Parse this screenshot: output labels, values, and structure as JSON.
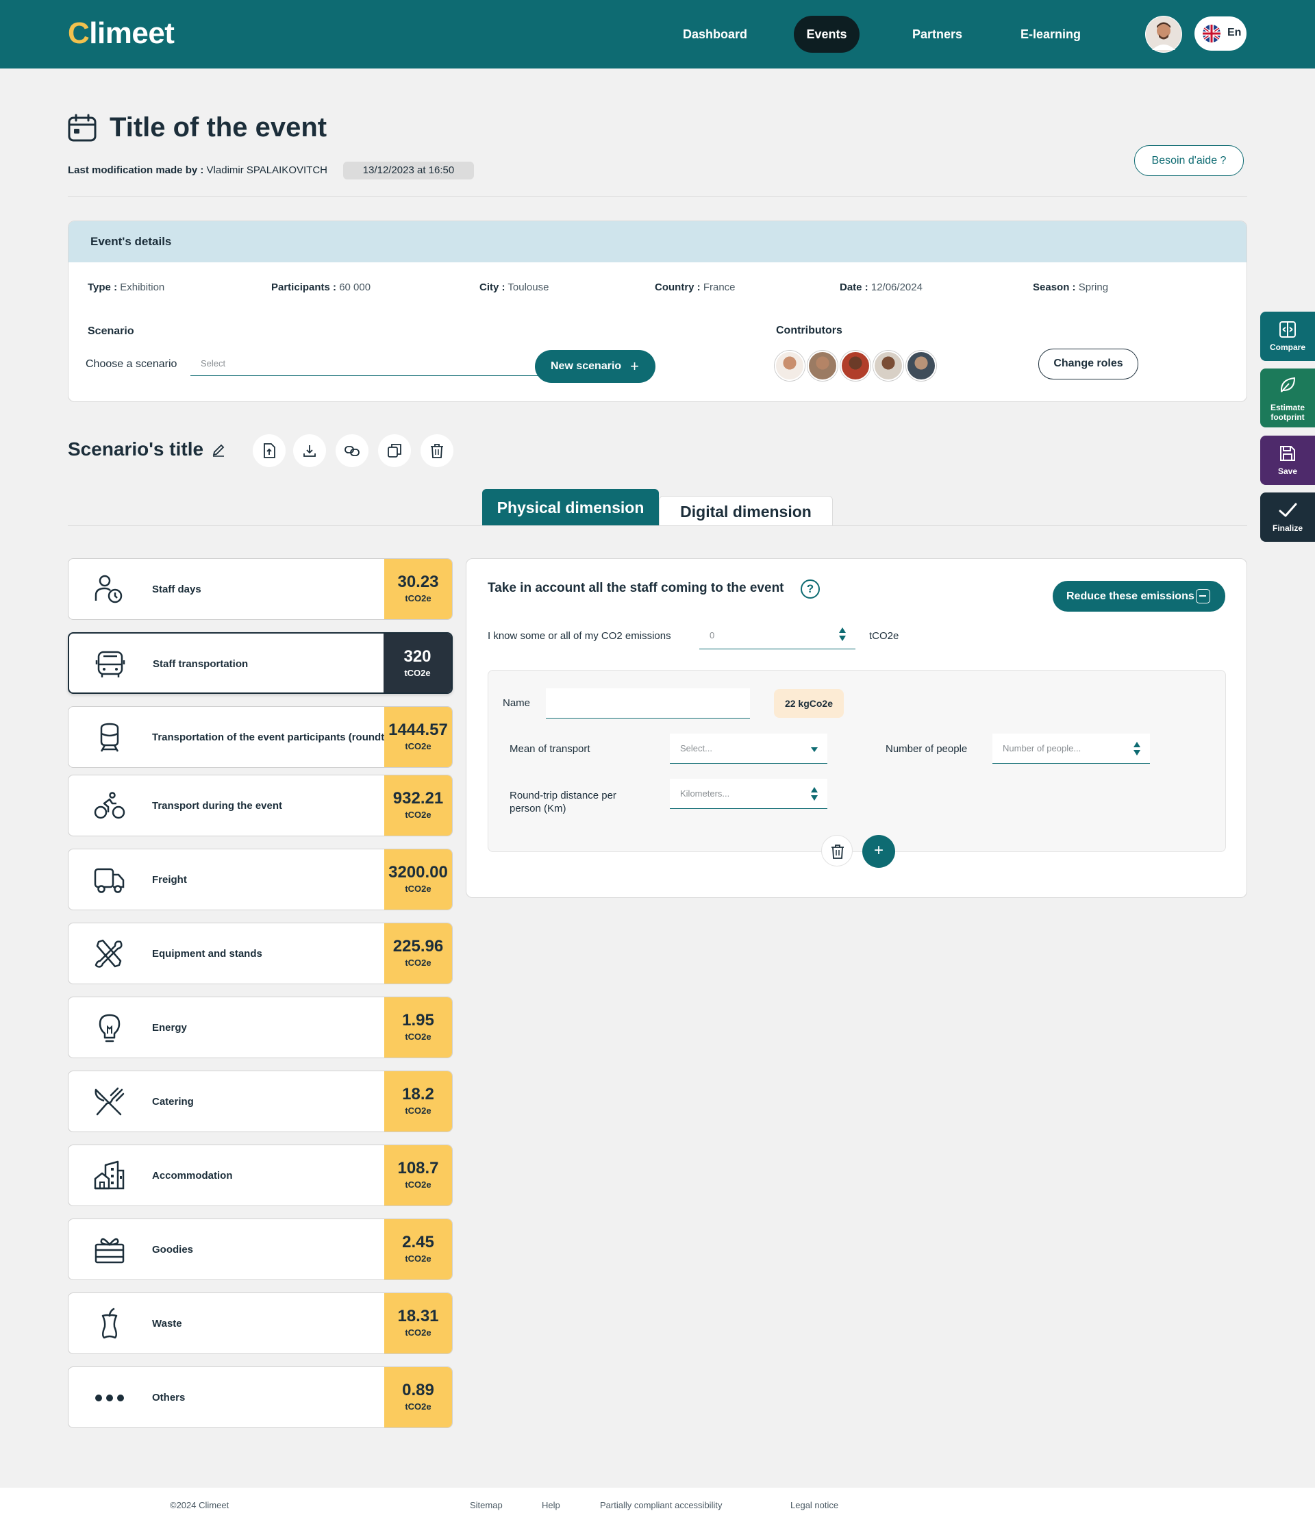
{
  "header": {
    "logo": "Climeet",
    "nav": [
      "Dashboard",
      "Events",
      "Partners",
      "E-learning"
    ],
    "active_nav": "Events",
    "language": "En"
  },
  "page": {
    "title": "Title of the event",
    "last_mod_label": "Last modification made by :",
    "last_mod_user": "Vladimir SPALAIKOVITCH",
    "last_mod_date": "13/12/2023 at 16:50",
    "help_label": "Besoin d'aide ?"
  },
  "details": {
    "heading": "Event's details",
    "meta": [
      {
        "key": "Type :",
        "value": "Exhibition"
      },
      {
        "key": "Participants :",
        "value": "60 000"
      },
      {
        "key": "City :",
        "value": "Toulouse"
      },
      {
        "key": "Country :",
        "value": "France"
      },
      {
        "key": "Date :",
        "value": "12/06/2024"
      },
      {
        "key": "Season :",
        "value": "Spring"
      }
    ],
    "scenario_label": "Scenario",
    "choose_label": "Choose a scenario",
    "select_placeholder": "Select",
    "new_scenario_label": "New scenario",
    "contributors_label": "Contributors",
    "change_roles_label": "Change roles"
  },
  "side_actions": [
    {
      "label": "Compare",
      "color": "#0e6b72"
    },
    {
      "label": "Estimate footprint",
      "color": "#1c7a5a"
    },
    {
      "label": "Save",
      "color": "#4e2a6b"
    },
    {
      "label": "Finalize",
      "color": "#1c2e3a"
    }
  ],
  "scenario": {
    "title": "Scenario's title"
  },
  "tabs": [
    "Physical dimension",
    "Digital dimension"
  ],
  "categories": [
    {
      "name": "Staff days",
      "value": "30.23",
      "unit": "tCO2e",
      "icon": "staff-days-icon"
    },
    {
      "name": "Staff transportation",
      "value": "320",
      "unit": "tCO2e",
      "icon": "bus-icon"
    },
    {
      "name": "Transportation of the event participants (roundtrip)",
      "value": "1444.57",
      "unit": "tCO2e",
      "icon": "train-icon"
    },
    {
      "name": "Transport during the event",
      "value": "932.21",
      "unit": "tCO2e",
      "icon": "bike-icon"
    },
    {
      "name": "Freight",
      "value": "3200.00",
      "unit": "tCO2e",
      "icon": "truck-icon"
    },
    {
      "name": "Equipment and stands",
      "value": "225.96",
      "unit": "tCO2e",
      "icon": "tools-icon"
    },
    {
      "name": "Energy",
      "value": "1.95",
      "unit": "tCO2e",
      "icon": "bulb-icon"
    },
    {
      "name": "Catering",
      "value": "18.2",
      "unit": "tCO2e",
      "icon": "cutlery-icon"
    },
    {
      "name": "Accommodation",
      "value": "108.7",
      "unit": "tCO2e",
      "icon": "building-icon"
    },
    {
      "name": "Goodies",
      "value": "2.45",
      "unit": "tCO2e",
      "icon": "gift-icon"
    },
    {
      "name": "Waste",
      "value": "18.31",
      "unit": "tCO2e",
      "icon": "apple-core-icon"
    },
    {
      "name": "Others",
      "value": "0.89",
      "unit": "tCO2e",
      "icon": "dots-icon"
    }
  ],
  "panel": {
    "title": "Take in account all the staff coming to the event",
    "reduce_label": "Reduce these emissions",
    "know_label": "I know some or all of my CO2 emissions",
    "co2_value": "0",
    "co2_unit": "tCO2e",
    "name_label": "Name",
    "kg_value": "22 kgCo2e",
    "transport_label": "Mean of transport",
    "transport_placeholder": "Select...",
    "people_label": "Number of people",
    "people_placeholder": "Number of people...",
    "distance_label": "Round-trip distance per person (Km)",
    "distance_placeholder": "Kilometers..."
  },
  "footer": {
    "copyright": "©2024 Climeet",
    "links": [
      "Sitemap",
      "Help",
      "Partially compliant accessibility",
      "Legal notice"
    ]
  }
}
